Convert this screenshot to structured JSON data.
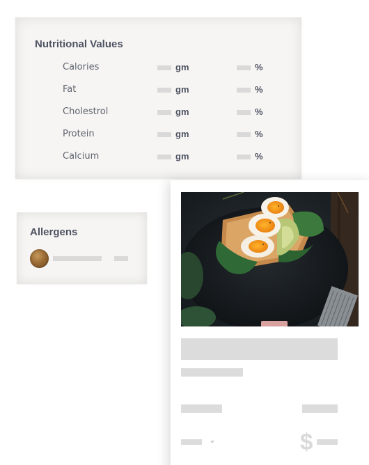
{
  "nutrition": {
    "title": "Nutritional Values",
    "rows": [
      {
        "label": "Calories",
        "unit_weight": "gm",
        "unit_percent": "%"
      },
      {
        "label": "Fat",
        "unit_weight": "gm",
        "unit_percent": "%"
      },
      {
        "label": "Cholestrol",
        "unit_weight": "gm",
        "unit_percent": "%"
      },
      {
        "label": "Protein",
        "unit_weight": "gm",
        "unit_percent": "%"
      },
      {
        "label": "Calcium",
        "unit_weight": "gm",
        "unit_percent": "%"
      }
    ]
  },
  "allergens": {
    "title": "Allergens",
    "items": [
      {
        "icon": "walnut-icon"
      }
    ]
  },
  "product": {
    "image": "egg-avocado-toast-photo",
    "currency_symbol": "$",
    "dropdown_icon": "chevron-down-icon"
  },
  "colors": {
    "card_background": "#f6f5f3",
    "heading_text": "#4e5362",
    "label_text": "#5f6470",
    "placeholder_bar": "#d9d9d9"
  }
}
